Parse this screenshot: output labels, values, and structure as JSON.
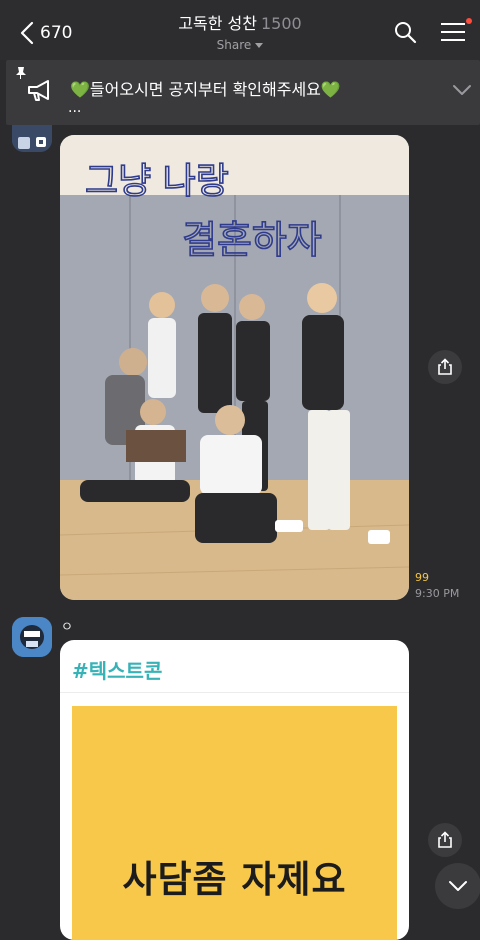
{
  "header": {
    "back_count": "670",
    "title": "고독한 성찬",
    "member_count": "1500",
    "share_label": "Share"
  },
  "notice": {
    "text": "💚들어오시면 공지부터 확인해주세요💚",
    "more": "..."
  },
  "messages": [
    {
      "type": "photo",
      "photo_text_line1": "그냥 나랑",
      "photo_text_line2": "결혼하자",
      "read_count": "99",
      "time": "9:30 PM"
    },
    {
      "type": "card",
      "sender": "ㅇ",
      "tag": "#텍스트콘",
      "image_text": "사담좀 자제요"
    }
  ],
  "icons": {
    "back": "chevron-left-icon",
    "search": "search-icon",
    "menu": "hamburger-menu-icon",
    "pin": "pin-icon",
    "megaphone": "megaphone-icon",
    "share": "share-icon",
    "scroll_down": "chevron-down-icon"
  },
  "colors": {
    "background": "#2b2b2e",
    "notice": "#3a3a3d",
    "read_count": "#f5c542",
    "tag": "#37b3b7",
    "card_image": "#f7c84a",
    "notification_dot": "#ff4c3b"
  }
}
